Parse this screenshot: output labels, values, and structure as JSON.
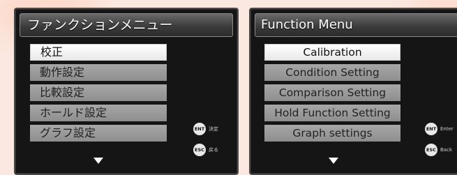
{
  "japanese_screen": {
    "title": "ファンクションメニュー",
    "items": [
      "校正",
      "動作設定",
      "比較設定",
      "ホールド設定",
      "グラフ設定"
    ],
    "selected_index": 0,
    "ent_hint": {
      "badge": "ENT",
      "label": "決定"
    },
    "esc_hint": {
      "badge": "ESC",
      "label": "戻る"
    }
  },
  "english_screen": {
    "title": "Function Menu",
    "items": [
      "Calibration",
      "Condition Setting",
      "Comparison Setting",
      "Hold Function Setting",
      "Graph settings"
    ],
    "selected_index": 0,
    "ent_hint": {
      "badge": "ENT",
      "label": "Enter"
    },
    "esc_hint": {
      "badge": "ESC",
      "label": "Back"
    }
  },
  "colors": {
    "background": "#fbe8e0",
    "screen": "#151515",
    "item": "#9b9b9b",
    "selected_item": "#ffffff"
  },
  "icons": [
    "scroll-down-arrow-icon",
    "ent-key-icon",
    "esc-key-icon"
  ]
}
